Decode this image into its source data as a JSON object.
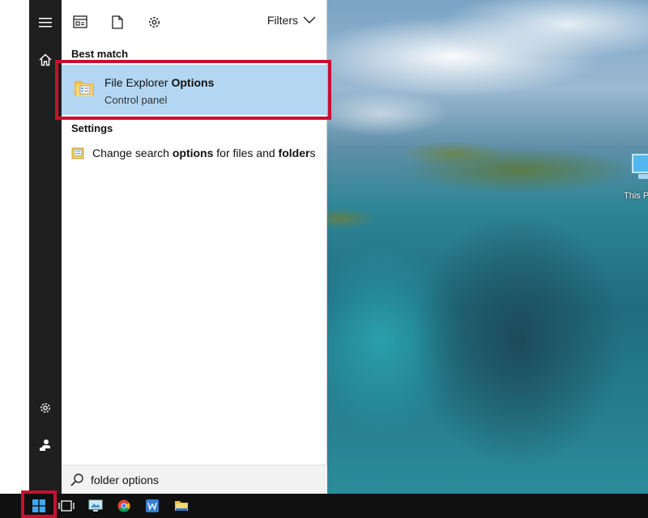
{
  "desktop": {
    "icon_label": "This P"
  },
  "toolbar": {
    "filters_label": "Filters",
    "icons": [
      "apps-icon",
      "document-icon",
      "settings-gear-icon"
    ]
  },
  "rail": {
    "icons": [
      "hamburger-menu-icon",
      "home-icon",
      "settings-gear-icon",
      "user-feedback-icon"
    ]
  },
  "results": {
    "best_match_heading": "Best match",
    "best_match": {
      "title_plain": "File Explorer ",
      "title_bold": "Options",
      "subtitle": "Control panel"
    },
    "settings_heading": "Settings",
    "settings_item": {
      "part1": "Change search ",
      "part2_bold": "options",
      "part3": " for files and ",
      "part4_bold": "folder",
      "part5": "s"
    }
  },
  "search": {
    "value": "folder options"
  },
  "taskbar": {
    "icons": [
      "windows-start-icon",
      "task-view-icon",
      "remote-desktop-icon",
      "chrome-icon",
      "word-icon",
      "file-explorer-icon"
    ]
  },
  "colors": {
    "highlight": "#b3d7f3",
    "annotation_red": "#c8102e",
    "rail_bg": "#1f1f1f",
    "taskbar_bg": "#101010"
  }
}
